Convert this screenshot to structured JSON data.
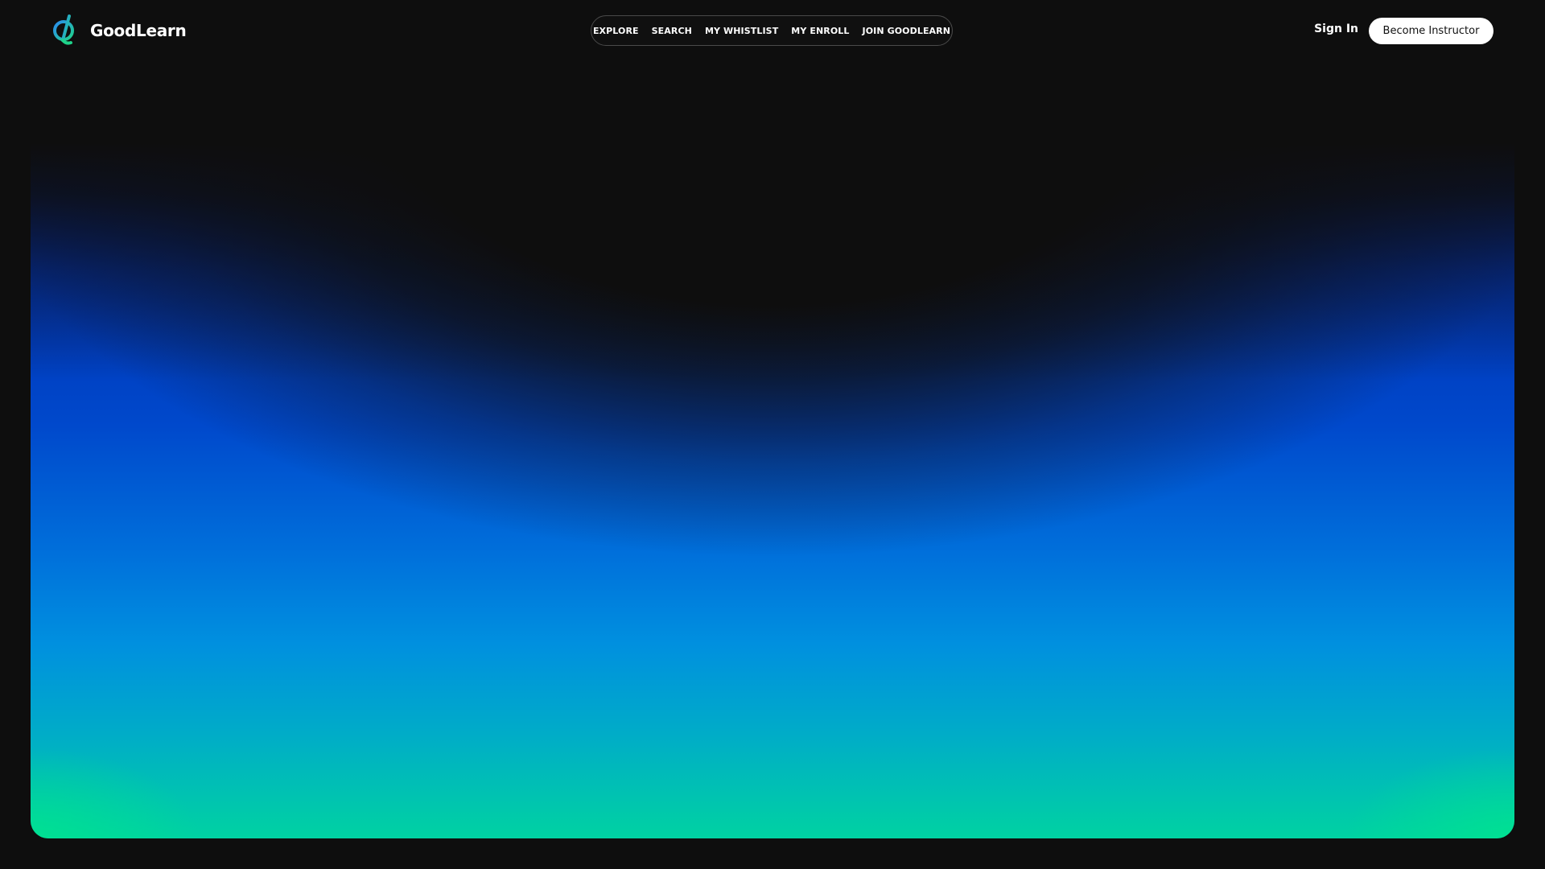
{
  "brand": {
    "name": "GoodLearn",
    "logo_icon": "goodlearn-logo-icon",
    "logo_colors": [
      "#2b8cf0",
      "#1fd38a"
    ]
  },
  "nav": {
    "items": [
      {
        "label": "EXPLORE"
      },
      {
        "label": "SEARCH"
      },
      {
        "label": "MY WHISTLIST"
      },
      {
        "label": "MY ENROLL"
      },
      {
        "label": "JOIN GOODLEARN"
      }
    ]
  },
  "auth": {
    "signin_label": "Sign In",
    "cta_label": "Become Instructor"
  },
  "theme": {
    "background": "#0e0e0e",
    "hero_gradient": [
      "#001a9a",
      "#0070db",
      "#00acc8",
      "#00e08c"
    ]
  }
}
